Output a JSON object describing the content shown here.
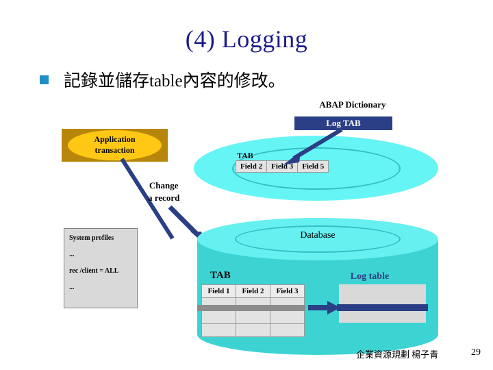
{
  "slide": {
    "title": "(4) Logging",
    "bullet": {
      "marker": "square-bullet",
      "text": "記錄並儲存table內容的修改。"
    },
    "footer": {
      "credit": "企業資源規劃 楊子青",
      "page_number": "29"
    }
  },
  "diagram": {
    "abap_dictionary": {
      "label": "ABAP Dictionary",
      "callout": "Log TAB",
      "tab_label": "TAB",
      "fields": [
        "Field 2",
        "Field 3",
        "Field 5"
      ]
    },
    "application": {
      "line1": "Application",
      "line2": "transaction",
      "connector_label_line1": "Change",
      "connector_label_line2": "a record"
    },
    "system_profiles": {
      "title": "System profiles",
      "lines": [
        "...",
        "rec /client = ALL",
        "..."
      ]
    },
    "database": {
      "label": "Database",
      "tab_label": "TAB",
      "tab_headers": [
        "Field 1",
        "Field 2",
        "Field 3"
      ],
      "log_table_label": "Log table"
    }
  },
  "colors": {
    "title_blue": "#1a1a8c",
    "bullet_blue": "#1f8fc6",
    "navy": "#2b3f86",
    "cyan_light": "#66f0f0",
    "cyan_dark": "#3ed3d3",
    "ring_teal": "#35bfc4",
    "gold_dark": "#b8860b",
    "gold_light": "#ffc815",
    "gray_box": "#d9d9d9",
    "gray_band": "#8c8c8c"
  }
}
